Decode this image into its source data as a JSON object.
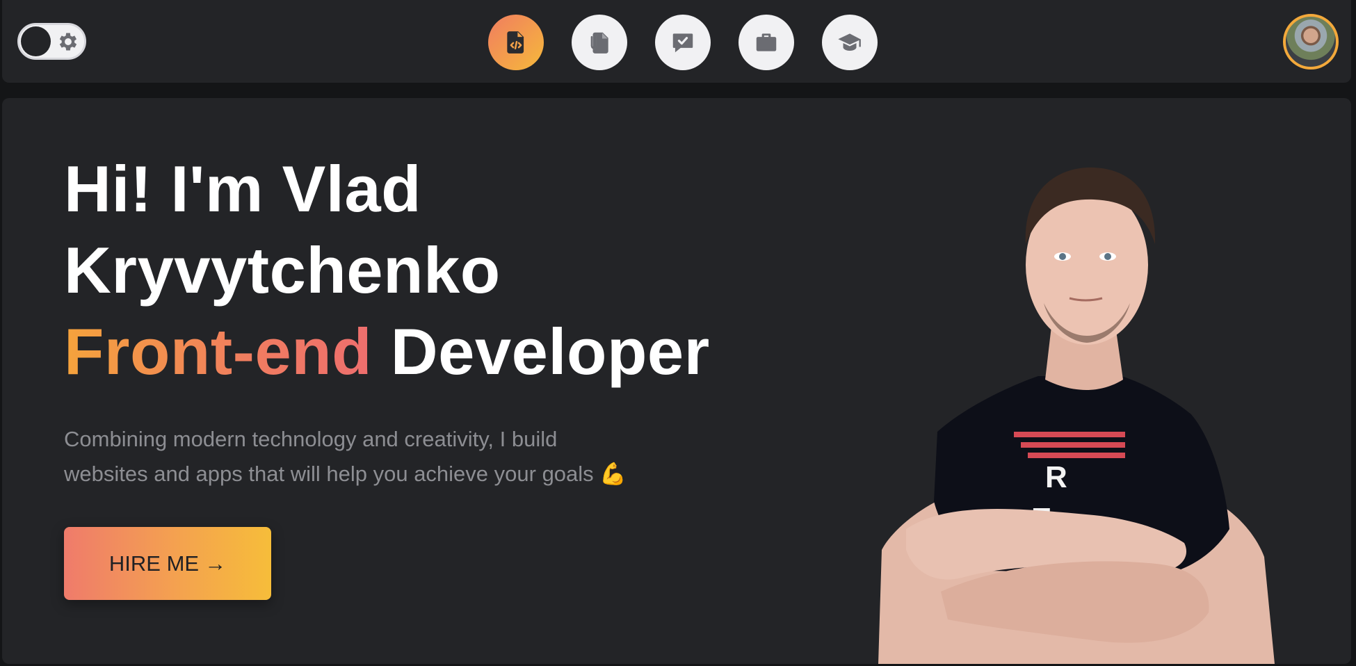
{
  "theme_toggle": {
    "icon": "gear-icon",
    "state": "dark"
  },
  "nav": {
    "items": [
      {
        "name": "code-file",
        "icon": "file-code-icon",
        "active": true
      },
      {
        "name": "attachments",
        "icon": "paperclip-file-icon",
        "active": false
      },
      {
        "name": "reviews",
        "icon": "chat-check-icon",
        "active": false
      },
      {
        "name": "portfolio",
        "icon": "briefcase-icon",
        "active": false
      },
      {
        "name": "education",
        "icon": "graduation-cap-icon",
        "active": false
      }
    ]
  },
  "hero": {
    "greeting": "Hi! I'm Vlad",
    "surname": "Kryvytchenko",
    "role_accent": "Front-end",
    "role_rest": "Developer",
    "description_line1": "Combining modern technology and creativity, I build",
    "description_line2": "websites and apps that will help you achieve your goals",
    "description_emoji": "💪",
    "hire_label": "HIRE ME",
    "hire_arrow": "→"
  },
  "colors": {
    "accent_start": "#f5a33c",
    "accent_end": "#ee6e6e",
    "panel_bg": "#232427",
    "page_bg": "#141517"
  }
}
